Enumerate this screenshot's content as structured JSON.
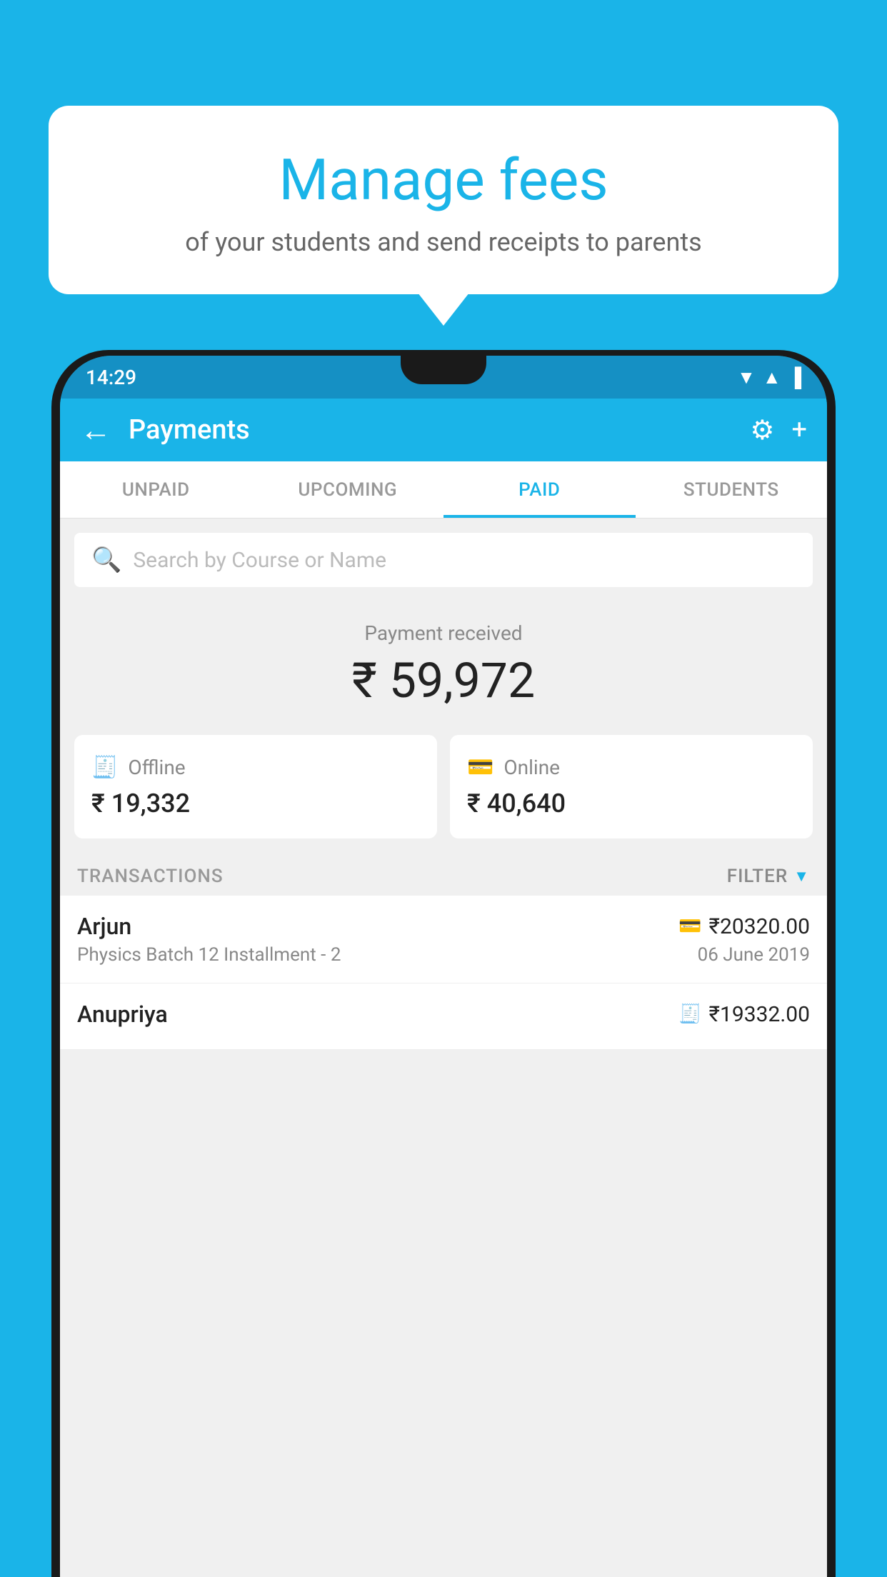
{
  "page": {
    "bg_color": "#1ab4e8"
  },
  "bubble": {
    "title": "Manage fees",
    "subtitle": "of your students and send receipts to parents"
  },
  "status_bar": {
    "time": "14:29"
  },
  "header": {
    "title": "Payments",
    "back_label": "←",
    "plus_label": "+"
  },
  "tabs": [
    {
      "label": "UNPAID",
      "active": false
    },
    {
      "label": "UPCOMING",
      "active": false
    },
    {
      "label": "PAID",
      "active": true
    },
    {
      "label": "STUDENTS",
      "active": false
    }
  ],
  "search": {
    "placeholder": "Search by Course or Name"
  },
  "payment_summary": {
    "label": "Payment received",
    "amount": "₹ 59,972"
  },
  "offline_card": {
    "label": "Offline",
    "amount": "₹ 19,332"
  },
  "online_card": {
    "label": "Online",
    "amount": "₹ 40,640"
  },
  "transactions_section": {
    "label": "TRANSACTIONS",
    "filter_label": "FILTER"
  },
  "transactions": [
    {
      "name": "Arjun",
      "course": "Physics Batch 12 Installment - 2",
      "amount": "₹20320.00",
      "date": "06 June 2019",
      "payment_type": "card"
    },
    {
      "name": "Anupriya",
      "course": "",
      "amount": "₹19332.00",
      "date": "",
      "payment_type": "cash"
    }
  ]
}
